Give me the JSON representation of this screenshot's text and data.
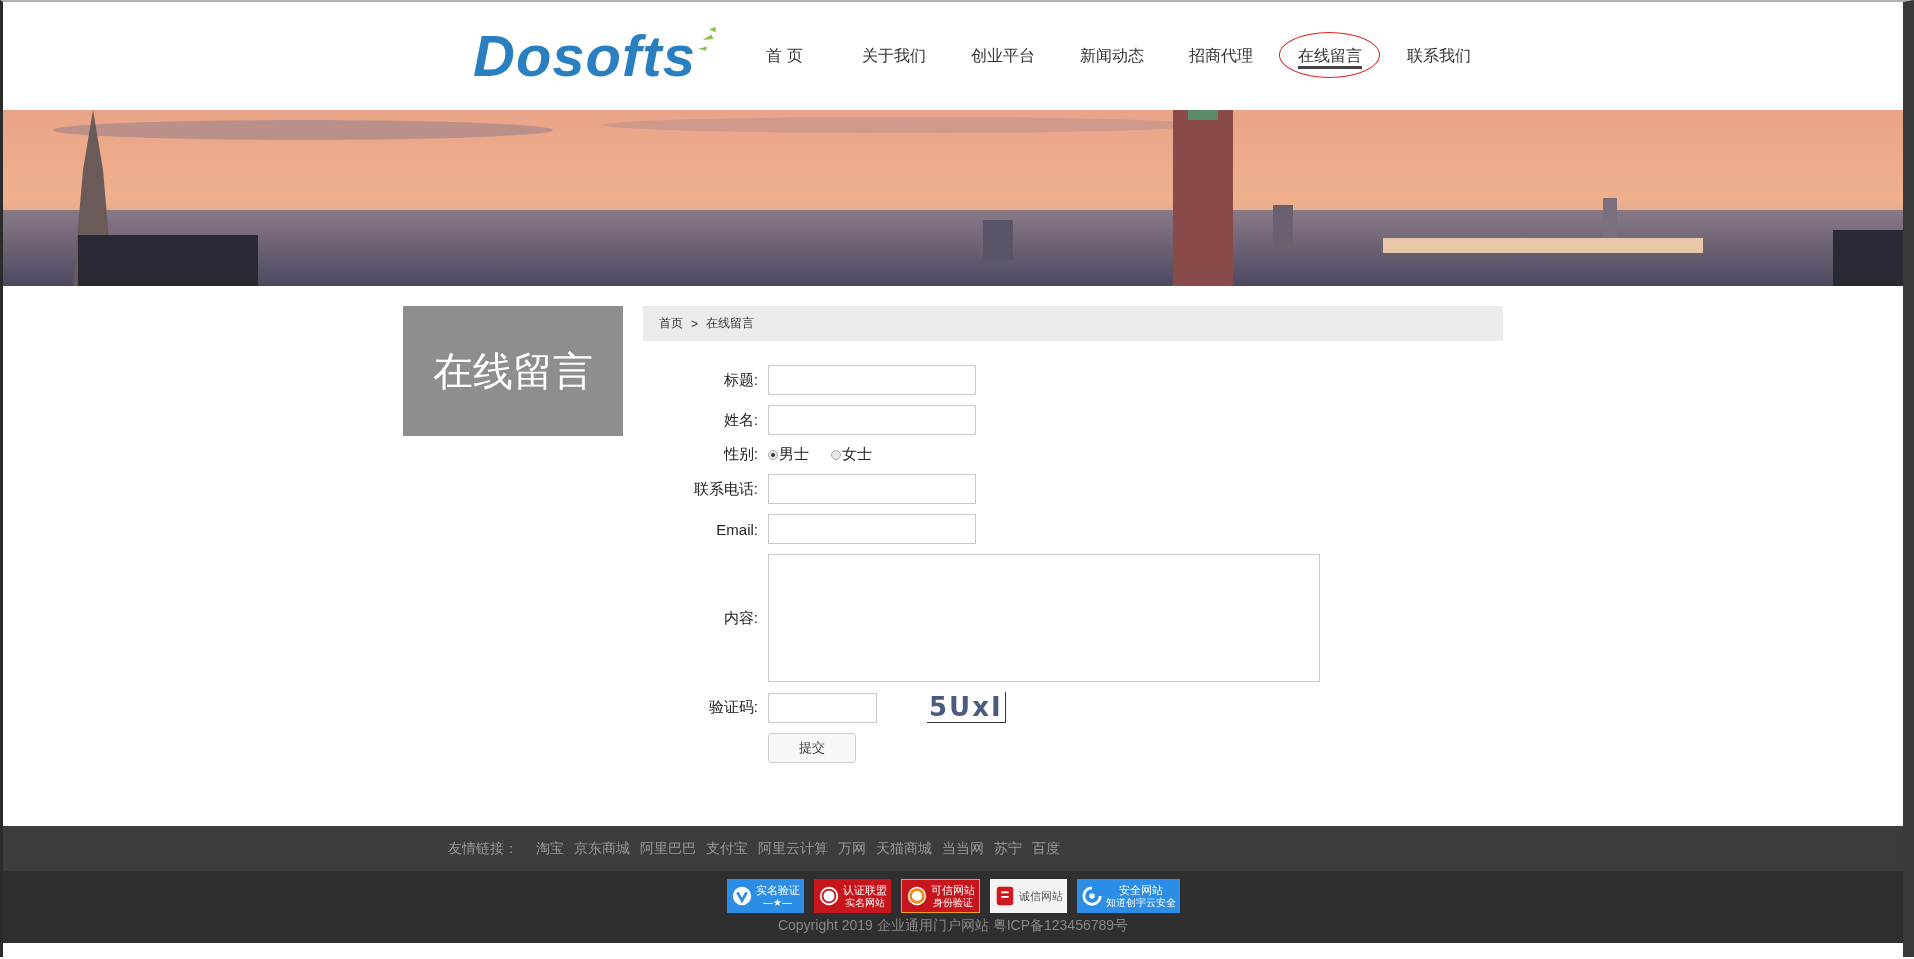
{
  "logo": {
    "text": "Dosofts"
  },
  "nav": [
    {
      "label": "首 页",
      "selected": false
    },
    {
      "label": "关于我们",
      "selected": false
    },
    {
      "label": "创业平台",
      "selected": false
    },
    {
      "label": "新闻动态",
      "selected": false
    },
    {
      "label": "招商代理",
      "selected": false
    },
    {
      "label": "在线留言",
      "selected": true
    },
    {
      "label": "联系我们",
      "selected": false
    }
  ],
  "sidebar": {
    "title": "在线留言"
  },
  "breadcrumb": [
    "首页",
    "在线留言"
  ],
  "breadcrumb_separator": ">",
  "form": {
    "fields": [
      {
        "kind": "text",
        "label": "标题:"
      },
      {
        "kind": "text",
        "label": "姓名:"
      },
      {
        "kind": "radio",
        "label": "性别:",
        "options": [
          {
            "label": "男士",
            "selected": true
          },
          {
            "label": "女士",
            "selected": false
          }
        ]
      },
      {
        "kind": "text",
        "label": "联系电话:"
      },
      {
        "kind": "text",
        "label": "Email:"
      },
      {
        "kind": "textarea",
        "label": "内容:"
      },
      {
        "kind": "captcha",
        "label": "验证码:",
        "captcha": "5UxI"
      }
    ],
    "submit": "提交"
  },
  "footer": {
    "links_label": "友情链接：",
    "links": [
      "淘宝",
      "京东商城",
      "阿里巴巴",
      "支付宝",
      "阿里云计算",
      "万网",
      "天猫商城",
      "当当网",
      "苏宁",
      "百度"
    ],
    "badges": [
      {
        "kind": "verify",
        "lines": [
          "实名验证",
          "—★—"
        ]
      },
      {
        "kind": "alliance",
        "lines": [
          "认证联盟",
          "实名网站"
        ]
      },
      {
        "kind": "trusted",
        "lines": [
          "可信网站",
          "身份验证"
        ]
      },
      {
        "kind": "credit",
        "lines": [
          "诚信网站"
        ]
      },
      {
        "kind": "secure",
        "lines": [
          "安全网站",
          "知道创宇云安全"
        ]
      }
    ],
    "copyright": "Copyright 2019 企业通用门户网站 粤ICP备123456789号"
  }
}
